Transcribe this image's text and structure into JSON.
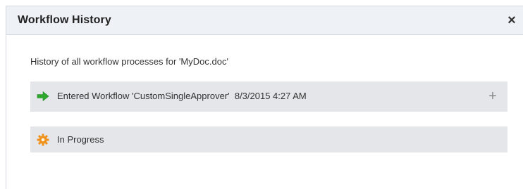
{
  "dialog": {
    "title": "Workflow History",
    "close_glyph": "×",
    "intro": "History of all workflow processes for 'MyDoc.doc'"
  },
  "history": {
    "entries": [
      {
        "icon": "arrow-right-icon",
        "icon_color": "#2ea82e",
        "label": "Entered Workflow 'CustomSingleApprover'",
        "timestamp": "8/3/2015 4:27 AM",
        "expand_glyph": "+"
      },
      {
        "icon": "gear-icon",
        "icon_color": "#f0921e",
        "label": "In Progress"
      }
    ]
  }
}
